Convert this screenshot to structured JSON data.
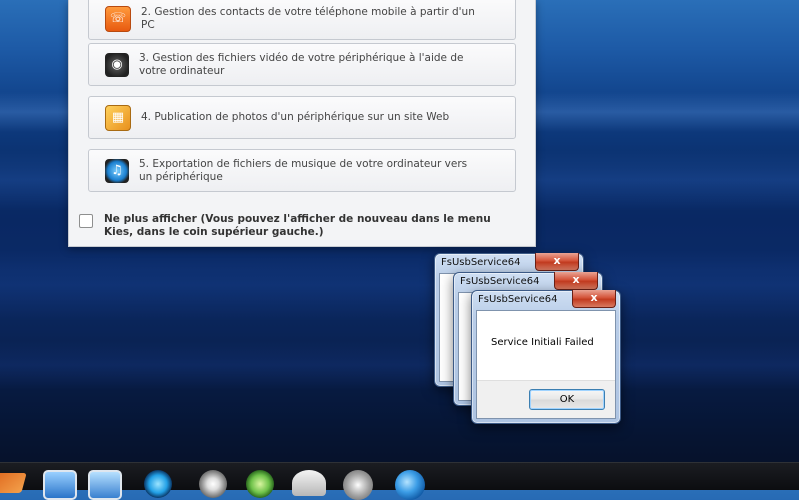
{
  "kies_panel": {
    "options": [
      {
        "icon": "phone-contacts-icon",
        "label": "2. Gestion des contacts de votre téléphone mobile à partir d'un PC"
      },
      {
        "icon": "film-reel-icon",
        "label": "3. Gestion des fichiers vidéo de votre périphérique à l'aide de votre ordinateur"
      },
      {
        "icon": "photo-icon",
        "label": "4. Publication de photos d'un périphérique sur un site Web"
      },
      {
        "icon": "music-icon",
        "label": "5. Exportation de fichiers de musique de votre ordinateur vers un périphérique"
      }
    ],
    "dont_show_label": "Ne plus afficher (Vous pouvez l'afficher de nouveau dans le menu Kies, dans le coin supérieur gauche.)"
  },
  "dialogs": [
    {
      "title": "FsUsbService64",
      "close": "x"
    },
    {
      "title": "FsUsbService64",
      "close": "x"
    },
    {
      "title": "FsUsbService64",
      "close": "x",
      "message": "Service Initiali Failed",
      "ok_label": "OK"
    }
  ],
  "taskbar": {
    "icons": [
      "pencil-icon",
      "photo-icon",
      "photo-gallery-icon",
      "music-icon",
      "film-reel-icon",
      "media-icon",
      "cd-box-icon",
      "disc-icon",
      "globe-icon"
    ]
  }
}
